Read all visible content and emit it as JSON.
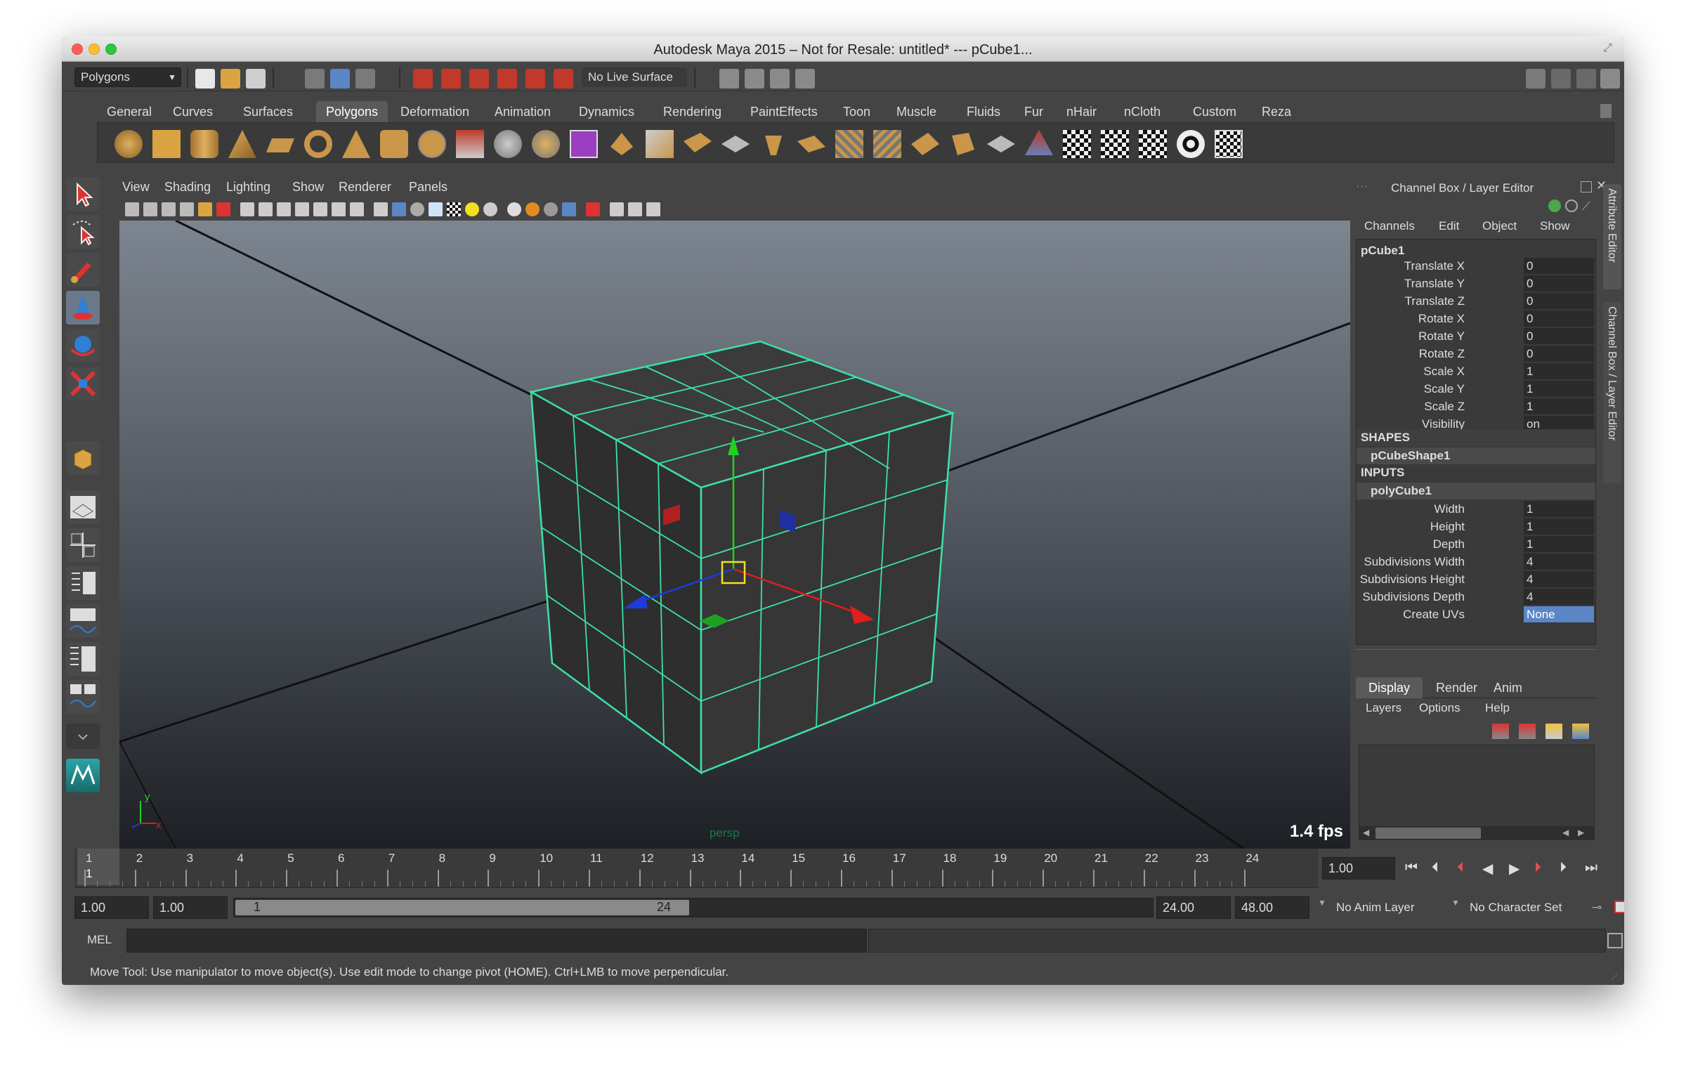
{
  "window": {
    "title": "Autodesk Maya 2015 – Not for Resale: untitled*    ---    pCube1..."
  },
  "status_line": {
    "menu_set": "Polygons",
    "live_surface": "No Live Surface"
  },
  "shelf": {
    "tabs": [
      "General",
      "Curves",
      "Surfaces",
      "Polygons",
      "Deformation",
      "Animation",
      "Dynamics",
      "Rendering",
      "PaintEffects",
      "Toon",
      "Muscle",
      "Fluids",
      "Fur",
      "nHair",
      "nCloth",
      "Custom",
      "Reza"
    ],
    "active_tab": "Polygons"
  },
  "viewport": {
    "menu": [
      "View",
      "Shading",
      "Lighting",
      "Show",
      "Renderer",
      "Panels"
    ],
    "camera_label": "persp",
    "fps": "1.4 fps",
    "axis_y": "y",
    "axis_x": "x"
  },
  "channel_box": {
    "title": "Channel Box / Layer Editor",
    "menu": [
      "Channels",
      "Edit",
      "Object",
      "Show"
    ],
    "object_name": "pCube1",
    "channels": [
      {
        "label": "Translate X",
        "value": "0"
      },
      {
        "label": "Translate Y",
        "value": "0"
      },
      {
        "label": "Translate Z",
        "value": "0"
      },
      {
        "label": "Rotate X",
        "value": "0"
      },
      {
        "label": "Rotate Y",
        "value": "0"
      },
      {
        "label": "Rotate Z",
        "value": "0"
      },
      {
        "label": "Scale X",
        "value": "1"
      },
      {
        "label": "Scale Y",
        "value": "1"
      },
      {
        "label": "Scale Z",
        "value": "1"
      },
      {
        "label": "Visibility",
        "value": "on"
      }
    ],
    "shapes_header": "SHAPES",
    "shape_name": "pCubeShape1",
    "inputs_header": "INPUTS",
    "input_name": "polyCube1",
    "inputs": [
      {
        "label": "Width",
        "value": "1"
      },
      {
        "label": "Height",
        "value": "1"
      },
      {
        "label": "Depth",
        "value": "1"
      },
      {
        "label": "Subdivisions Width",
        "value": "4"
      },
      {
        "label": "Subdivisions Height",
        "value": "4"
      },
      {
        "label": "Subdivisions Depth",
        "value": "4"
      },
      {
        "label": "Create UVs",
        "value": "None"
      }
    ]
  },
  "layer_editor": {
    "tabs": [
      "Display",
      "Render",
      "Anim"
    ],
    "active_tab": "Display",
    "menu": [
      "Layers",
      "Options",
      "Help"
    ]
  },
  "side_tabs": [
    "Attribute Editor",
    "Channel Box / Layer Editor"
  ],
  "timeline": {
    "frames": [
      "1",
      "2",
      "3",
      "4",
      "5",
      "6",
      "7",
      "8",
      "9",
      "10",
      "11",
      "12",
      "13",
      "14",
      "15",
      "16",
      "17",
      "18",
      "19",
      "20",
      "21",
      "22",
      "23",
      "24"
    ],
    "current_frame_marker": "1",
    "current_time": "1.00"
  },
  "range": {
    "start_time": "1.00",
    "playback_start": "1.00",
    "slider_start": "1",
    "slider_end": "24",
    "playback_end": "24.00",
    "end_time": "48.00",
    "anim_layer": "No Anim Layer",
    "character_set": "No Character Set"
  },
  "command_line": {
    "label": "MEL"
  },
  "help_line": {
    "text": "Move Tool: Use manipulator to move object(s). Use edit mode to change pivot (HOME).  Ctrl+LMB to move perpendicular."
  },
  "colors": {
    "wire": "#3de0a8",
    "accent": "#5b86c5",
    "panel": "#444444"
  }
}
